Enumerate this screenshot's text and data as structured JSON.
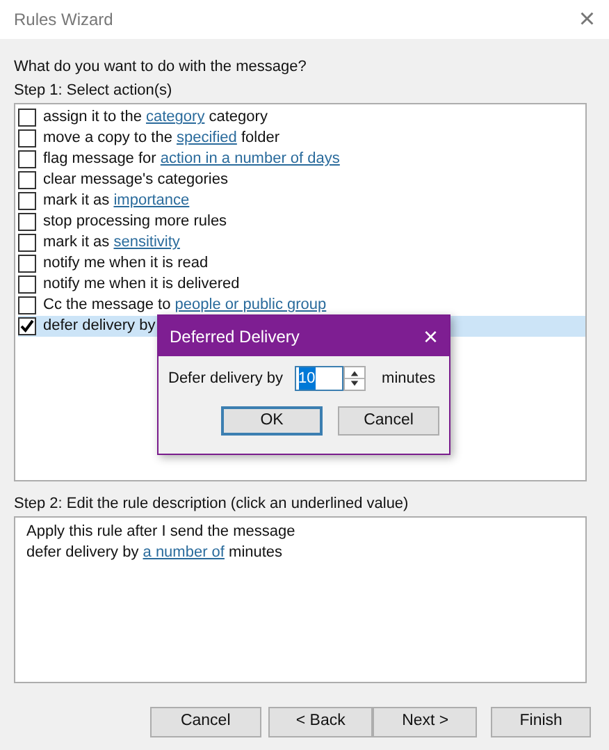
{
  "window": {
    "title": "Rules Wizard",
    "close": "×"
  },
  "prompt": "What do you want to do with the message?",
  "step1_label": "Step 1: Select action(s)",
  "actions": [
    {
      "checked": false,
      "selected": false,
      "parts": [
        {
          "text": "assign it to the ",
          "link": false
        },
        {
          "text": "category",
          "link": true
        },
        {
          "text": " category",
          "link": false
        }
      ]
    },
    {
      "checked": false,
      "selected": false,
      "parts": [
        {
          "text": "move a copy to the ",
          "link": false
        },
        {
          "text": "specified",
          "link": true
        },
        {
          "text": " folder",
          "link": false
        }
      ]
    },
    {
      "checked": false,
      "selected": false,
      "parts": [
        {
          "text": "flag message for ",
          "link": false
        },
        {
          "text": "action in a number of days",
          "link": true
        }
      ]
    },
    {
      "checked": false,
      "selected": false,
      "parts": [
        {
          "text": "clear message's categories",
          "link": false
        }
      ]
    },
    {
      "checked": false,
      "selected": false,
      "parts": [
        {
          "text": "mark it as ",
          "link": false
        },
        {
          "text": "importance",
          "link": true
        }
      ]
    },
    {
      "checked": false,
      "selected": false,
      "parts": [
        {
          "text": "stop processing more rules",
          "link": false
        }
      ]
    },
    {
      "checked": false,
      "selected": false,
      "parts": [
        {
          "text": "mark it as ",
          "link": false
        },
        {
          "text": "sensitivity",
          "link": true
        }
      ]
    },
    {
      "checked": false,
      "selected": false,
      "parts": [
        {
          "text": "notify me when it is read",
          "link": false
        }
      ]
    },
    {
      "checked": false,
      "selected": false,
      "parts": [
        {
          "text": "notify me when it is delivered",
          "link": false
        }
      ]
    },
    {
      "checked": false,
      "selected": false,
      "parts": [
        {
          "text": "Cc the message to ",
          "link": false
        },
        {
          "text": "people or public group",
          "link": true
        }
      ]
    },
    {
      "checked": true,
      "selected": true,
      "parts": [
        {
          "text": "defer delivery by",
          "link": false
        }
      ]
    }
  ],
  "dialog": {
    "title": "Deferred Delivery",
    "close": "×",
    "label": "Defer delivery by",
    "value": "10",
    "unit": "minutes",
    "buttons": [
      {
        "label": "OK",
        "focused": true
      },
      {
        "label": "Cancel",
        "focused": false
      }
    ]
  },
  "step2_label": "Step 2: Edit the rule description (click an underlined value)",
  "description": [
    {
      "parts": [
        {
          "text": "Apply this rule after I send the message",
          "link": false
        }
      ]
    },
    {
      "parts": [
        {
          "text": "defer delivery by ",
          "link": false
        },
        {
          "text": "a number of",
          "link": true
        },
        {
          "text": " minutes",
          "link": false
        }
      ]
    }
  ],
  "buttons": [
    {
      "label": "Cancel"
    },
    {
      "label": "< Back"
    },
    {
      "label": "Next >"
    },
    {
      "label": "Finish"
    }
  ]
}
